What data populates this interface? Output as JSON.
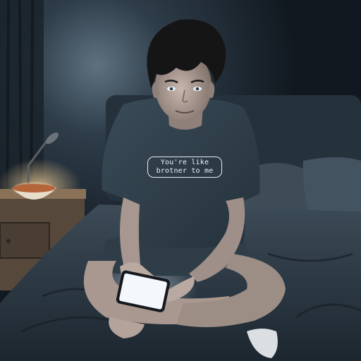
{
  "scene": {
    "shirt_text": {
      "line1": "You're like",
      "line2": "brotner to me"
    }
  },
  "colors": {
    "wall": "#1b2631",
    "wall_glow": "#5f7180",
    "bed_sheet": "#2c3a45",
    "pillow": "#3d4c57",
    "nightstand": "#6d5a48",
    "lamp_glow": "#ffd9a0",
    "shirt": "#2e3e49",
    "skin": "#b7a59c",
    "hair": "#161515",
    "phone_screen": "#f4f7fb"
  }
}
